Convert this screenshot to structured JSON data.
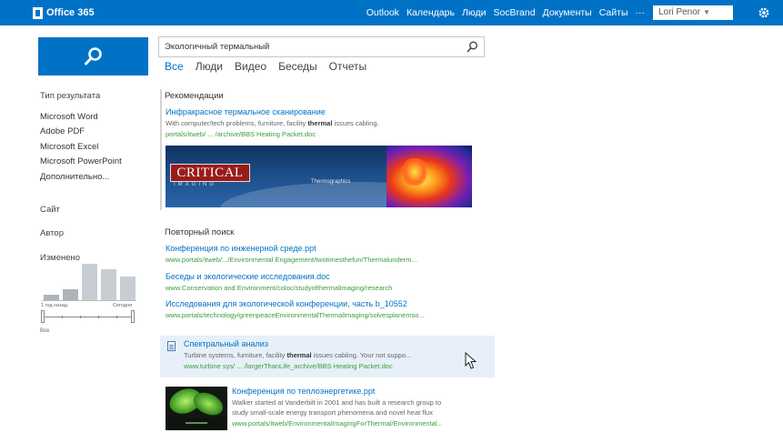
{
  "topbar": {
    "brand": "Office 365",
    "nav": [
      "Outlook",
      "Календарь",
      "Люди",
      "SocBrand",
      "Документы",
      "Сайты",
      "···"
    ],
    "user": "Lori Penor",
    "colors": {
      "bar": "#0072c6"
    }
  },
  "search": {
    "query": "Экологичный термальный",
    "icon": "search-icon",
    "verticals": [
      "Все",
      "Люди",
      "Видео",
      "Беседы",
      "Отчеты"
    ],
    "active_vertical": "Все"
  },
  "refiners": {
    "result_type": {
      "heading": "Тип результата",
      "items": [
        "Microsoft Word",
        "Adobe PDF",
        "Microsoft Excel",
        "Microsoft PowerPoint",
        "Дополнительно..."
      ]
    },
    "site_heading": "Сайт",
    "author_heading": "Автор",
    "modified": {
      "heading": "Изменено",
      "histogram": [
        0.15,
        0.3,
        1.0,
        0.85,
        0.65
      ],
      "left_label": "1 год назад",
      "right_label": "Сегодня",
      "range_label": "Все"
    }
  },
  "recommendations": {
    "heading": "Рекомендации",
    "result": {
      "title": "Инфракрасное термальное сканирование",
      "snippet_before": "With computer/tech problems, furniture, facility ",
      "snippet_bold": "thermal",
      "snippet_after": " issues cabling.",
      "url": "portals/itweb/ ... /archive/BBS Heating Packet.doc"
    },
    "banner": {
      "brand": "CRITICAL",
      "sub": "IMAGING",
      "caption": "Thermographics"
    }
  },
  "repeat_search": {
    "heading": "Повторный поиск",
    "results": [
      {
        "title": "Конференция по инженерной среде.ppt",
        "url": "www.portals/itweb/.../Environmental Engagement/twotimesthefun/Thermalunderm..."
      },
      {
        "title": "Беседы и экологические исследования.doc",
        "url": "www.Conservation and Environment/coloc/studyofthermalimaging/research"
      },
      {
        "title": "Исследования для экологической конференции, часть b_10552",
        "url": "www.portals/technology/greenpeaceEnvironmentalThermalImaging/solvesplanemso..."
      }
    ]
  },
  "hovered_result": {
    "title": "Спектральный анализ",
    "snippet_before": "Turbine systems, furniture, facility ",
    "snippet_bold": "thermal",
    "snippet_after": " issues cabling. Your not suppo...",
    "url": "www.turbine sys/ ... /largerThanLife_archive/BBS Heating Packet.doc"
  },
  "ppt_result": {
    "title": "Конференция по теплоэнергетике.ppt",
    "snippet_line1": "Walker started at Vanderbilt in 2001 and has built a research group to",
    "snippet_line2": "study small-scale energy transport phenomena and novel heat flux",
    "url": "www.portals/itweb/EnvironmentalImagingForThermal/Environmental..."
  }
}
